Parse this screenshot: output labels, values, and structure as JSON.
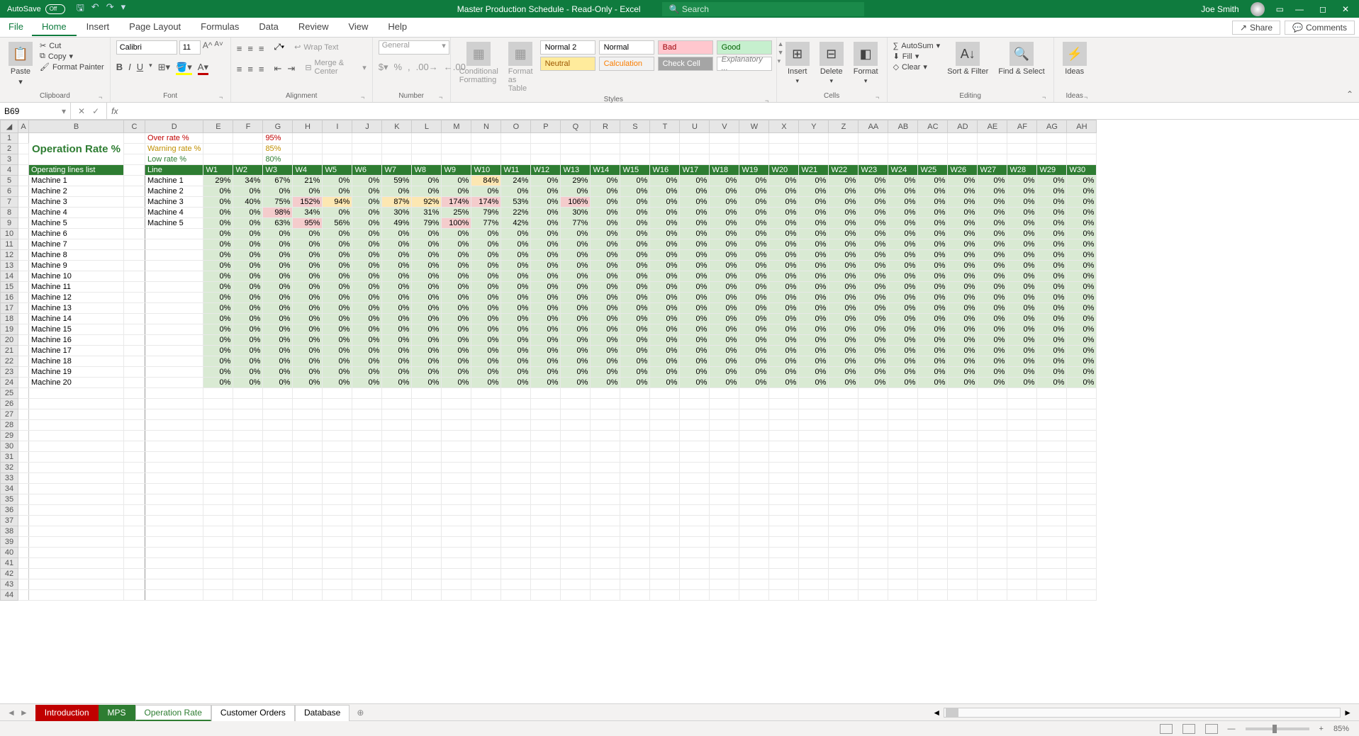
{
  "title_bar": {
    "autosave_label": "AutoSave",
    "autosave_state": "Off",
    "doc_title": "Master Production Schedule - Read-Only - Excel",
    "search_placeholder": "Search",
    "user_name": "Joe Smith"
  },
  "ribbon_tabs": [
    "File",
    "Home",
    "Insert",
    "Page Layout",
    "Formulas",
    "Data",
    "Review",
    "View",
    "Help"
  ],
  "ribbon_active": "Home",
  "share_label": "Share",
  "comments_label": "Comments",
  "ribbon": {
    "clipboard": {
      "label": "Clipboard",
      "paste": "Paste",
      "cut": "Cut",
      "copy": "Copy",
      "painter": "Format Painter"
    },
    "font": {
      "label": "Font",
      "name": "Calibri",
      "size": "11"
    },
    "alignment": {
      "label": "Alignment",
      "wrap": "Wrap Text",
      "merge": "Merge & Center"
    },
    "number": {
      "label": "Number",
      "format": "General"
    },
    "styles_group": {
      "label": "Styles",
      "cond": "Conditional Formatting",
      "table": "Format as Table",
      "pills": [
        "Normal 2",
        "Normal",
        "Bad",
        "Good",
        "Neutral",
        "Calculation",
        "Check Cell",
        "Explanatory ..."
      ]
    },
    "cells": {
      "label": "Cells",
      "insert": "Insert",
      "delete": "Delete",
      "format": "Format"
    },
    "editing": {
      "label": "Editing",
      "autosum": "AutoSum",
      "fill": "Fill",
      "clear": "Clear",
      "sort": "Sort & Filter",
      "find": "Find & Select"
    },
    "ideas": {
      "label": "Ideas",
      "btn": "Ideas"
    }
  },
  "name_box": "B69",
  "columns": [
    "A",
    "B",
    "C",
    "D",
    "E",
    "F",
    "G",
    "H",
    "I",
    "J",
    "K",
    "L",
    "M",
    "N",
    "O",
    "P",
    "Q",
    "R",
    "S",
    "T",
    "U",
    "V",
    "W",
    "X",
    "Y",
    "Z",
    "AA",
    "AB",
    "AC",
    "AD",
    "AE",
    "AF",
    "AG",
    "AH"
  ],
  "sheet": {
    "title": "Operation Rate %",
    "thresholds": {
      "over_label": "Over rate %",
      "over_val": "95%",
      "warn_label": "Warning rate %",
      "warn_val": "85%",
      "low_label": "Low rate %",
      "low_val": "80%"
    },
    "list_header": "Operating lines list",
    "line_header": "Line",
    "weeks": [
      "W1",
      "W2",
      "W3",
      "W4",
      "W5",
      "W6",
      "W7",
      "W8",
      "W9",
      "W10",
      "W11",
      "W12",
      "W13",
      "W14",
      "W15",
      "W16",
      "W17",
      "W18",
      "W19",
      "W20",
      "W21",
      "W22",
      "W23",
      "W24",
      "W25",
      "W26",
      "W27",
      "W28",
      "W29",
      "W30"
    ],
    "machines_list": [
      "Machine 1",
      "Machine 2",
      "Machine 3",
      "Machine 4",
      "Machine 5",
      "Machine 6",
      "Machine 7",
      "Machine 8",
      "Machine 9",
      "Machine 10",
      "Machine 11",
      "Machine 12",
      "Machine 13",
      "Machine 14",
      "Machine 15",
      "Machine 16",
      "Machine 17",
      "Machine 18",
      "Machine 19",
      "Machine 20"
    ],
    "data_rows": [
      {
        "name": "Machine 1",
        "vals": [
          29,
          34,
          67,
          21,
          0,
          0,
          59,
          0,
          0,
          84,
          24,
          0,
          29,
          0,
          0,
          0,
          0,
          0,
          0,
          0,
          0,
          0,
          0,
          0,
          0,
          0,
          0,
          0,
          0,
          0
        ],
        "hi": {
          "9": "orange"
        }
      },
      {
        "name": "Machine 2",
        "vals": [
          0,
          0,
          0,
          0,
          0,
          0,
          0,
          0,
          0,
          0,
          0,
          0,
          0,
          0,
          0,
          0,
          0,
          0,
          0,
          0,
          0,
          0,
          0,
          0,
          0,
          0,
          0,
          0,
          0,
          0
        ]
      },
      {
        "name": "Machine 3",
        "vals": [
          0,
          40,
          75,
          152,
          94,
          0,
          87,
          92,
          174,
          174,
          53,
          0,
          106,
          0,
          0,
          0,
          0,
          0,
          0,
          0,
          0,
          0,
          0,
          0,
          0,
          0,
          0,
          0,
          0,
          0
        ],
        "hi": {
          "3": "red",
          "4": "orange",
          "6": "orange",
          "7": "orange",
          "8": "red",
          "9": "red",
          "12": "red"
        }
      },
      {
        "name": "Machine 4",
        "vals": [
          0,
          0,
          98,
          34,
          0,
          0,
          30,
          31,
          25,
          79,
          22,
          0,
          30,
          0,
          0,
          0,
          0,
          0,
          0,
          0,
          0,
          0,
          0,
          0,
          0,
          0,
          0,
          0,
          0,
          0
        ],
        "hi": {
          "2": "red"
        }
      },
      {
        "name": "Machine 5",
        "vals": [
          0,
          0,
          63,
          95,
          56,
          0,
          49,
          79,
          100,
          77,
          42,
          0,
          77,
          0,
          0,
          0,
          0,
          0,
          0,
          0,
          0,
          0,
          0,
          0,
          0,
          0,
          0,
          0,
          0,
          0
        ],
        "hi": {
          "3": "red",
          "8": "red"
        }
      }
    ]
  },
  "sheet_tabs": [
    "Introduction",
    "MPS",
    "Operation Rate",
    "Customer Orders",
    "Database"
  ],
  "sheet_active": "Operation Rate",
  "status": {
    "zoom": "85%"
  }
}
